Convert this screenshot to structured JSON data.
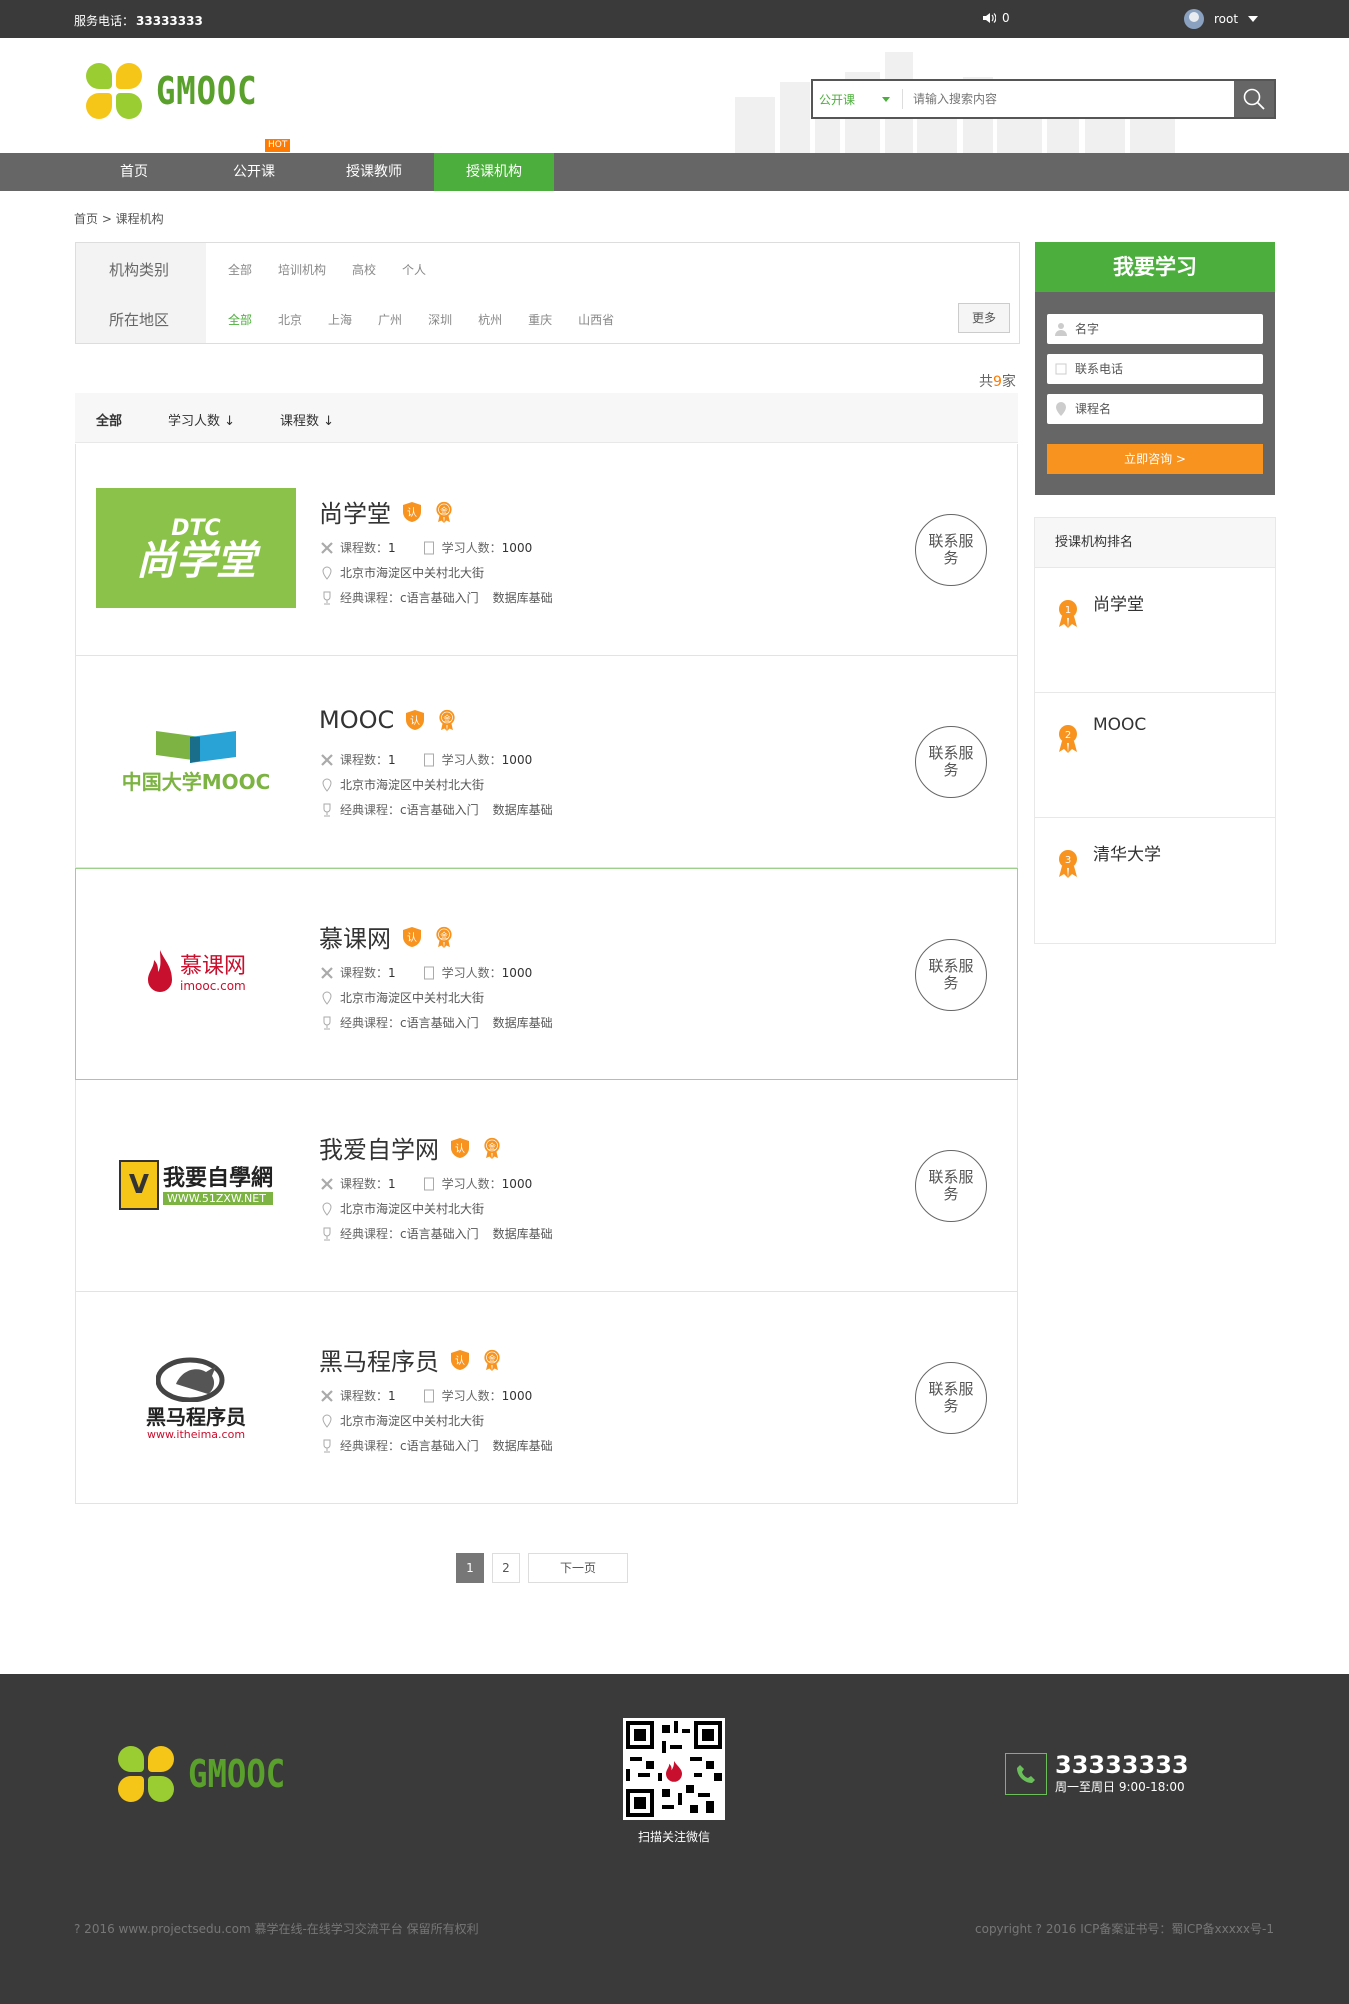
{
  "topbar": {
    "phone_label": "服务电话：",
    "phone_value": "33333333",
    "notice_count": "0",
    "username": "root"
  },
  "brand": {
    "name": "GMOOC"
  },
  "search": {
    "category": "公开课",
    "placeholder": "请输入搜索内容"
  },
  "nav": {
    "hot": "HOT",
    "items": [
      {
        "label": "首页"
      },
      {
        "label": "公开课"
      },
      {
        "label": "授课教师"
      },
      {
        "label": "授课机构"
      }
    ]
  },
  "breadcrumb": "首页 > 课程机构",
  "filter": {
    "category_label": "机构类别",
    "categories": [
      "全部",
      "培训机构",
      "高校",
      "个人"
    ],
    "region_label": "所在地区",
    "regions": [
      "全部",
      "北京",
      "上海",
      "广州",
      "深圳",
      "杭州",
      "重庆",
      "山西省"
    ],
    "more": "更多"
  },
  "total": {
    "prefix": "共",
    "count": "9",
    "suffix": "家"
  },
  "sort": {
    "all": "全部",
    "students": "学习人数 ↓",
    "courses": "课程数 ↓"
  },
  "orgs": [
    {
      "name": "尚学堂",
      "courses_label": "课程数：",
      "courses": "1",
      "students_label": "学习人数：",
      "students": "1000",
      "address": "北京市海淀区中关村北大街",
      "classic_label": "经典课程：",
      "classic1": "c语言基础入门",
      "classic2": "数据库基础",
      "logo_text": "尚学堂",
      "logo_sub": "DTC",
      "service": "联系服务",
      "badge_cert": "认",
      "badge_gold": "金"
    },
    {
      "name": "MOOC",
      "courses_label": "课程数：",
      "courses": "1",
      "students_label": "学习人数：",
      "students": "1000",
      "address": "北京市海淀区中关村北大街",
      "classic_label": "经典课程：",
      "classic1": "c语言基础入门",
      "classic2": "数据库基础",
      "logo_text": "中国大学MOOC",
      "service": "联系服务",
      "badge_cert": "认",
      "badge_gold": "金"
    },
    {
      "name": "慕课网",
      "courses_label": "课程数：",
      "courses": "1",
      "students_label": "学习人数：",
      "students": "1000",
      "address": "北京市海淀区中关村北大街",
      "classic_label": "经典课程：",
      "classic1": "c语言基础入门",
      "classic2": "数据库基础",
      "logo_text": "慕课网",
      "logo_sub": "imooc.com",
      "service": "联系服务",
      "badge_cert": "认",
      "badge_gold": "金"
    },
    {
      "name": "我爱自学网",
      "courses_label": "课程数：",
      "courses": "1",
      "students_label": "学习人数：",
      "students": "1000",
      "address": "北京市海淀区中关村北大街",
      "classic_label": "经典课程：",
      "classic1": "c语言基础入门",
      "classic2": "数据库基础",
      "logo_text": "我要自學網",
      "logo_sub": "WWW.51ZXW.NET",
      "service": "联系服务",
      "badge_cert": "认",
      "badge_gold": "金"
    },
    {
      "name": "黑马程序员",
      "courses_label": "课程数：",
      "courses": "1",
      "students_label": "学习人数：",
      "students": "1000",
      "address": "北京市海淀区中关村北大街",
      "classic_label": "经典课程：",
      "classic1": "c语言基础入门",
      "classic2": "数据库基础",
      "logo_text": "黑马程序员",
      "logo_sub": "www.itheima.com",
      "service": "联系服务",
      "badge_cert": "认",
      "badge_gold": "金"
    }
  ],
  "pager": {
    "p1": "1",
    "p2": "2",
    "next": "下一页"
  },
  "learn": {
    "title": "我要学习",
    "name_ph": "名字",
    "phone_ph": "联系电话",
    "course_ph": "课程名",
    "submit": "立即咨询 >"
  },
  "rank": {
    "title": "授课机构排名",
    "items": [
      {
        "no": "1",
        "name": "尚学堂"
      },
      {
        "no": "2",
        "name": "MOOC"
      },
      {
        "no": "3",
        "name": "清华大学"
      }
    ]
  },
  "footer": {
    "qr_caption": "扫描关注微信",
    "tel": "33333333",
    "hours": "周一至周日 9:00-18:00",
    "copyright_left": "? 2016 www.projectsedu.com 慕学在线-在线学习交流平台 保留所有权利",
    "copyright_right": "copyright ? 2016 ICP备案证书号：蜀ICP备xxxxx号-1"
  },
  "colors": {
    "accent": "#4cae3c",
    "orange": "#f7931e",
    "dark": "#3a3a3a",
    "nav": "#666666"
  }
}
